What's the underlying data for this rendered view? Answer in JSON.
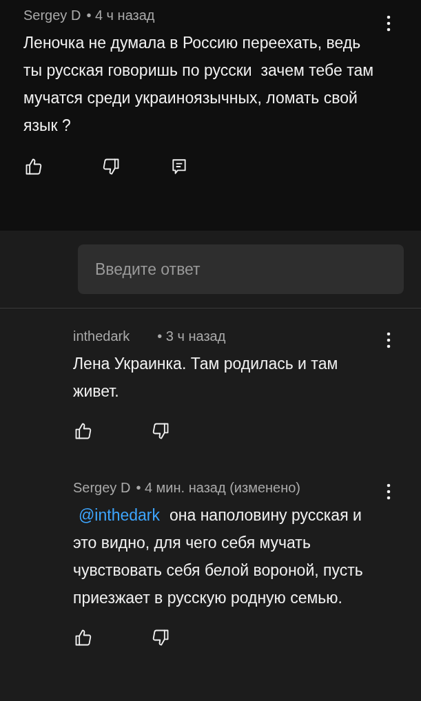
{
  "comment": {
    "author": "Sergey D",
    "time": "• 4 ч назад",
    "text": "Леночка не думала в Россию переехать, ведь ты русская говоришь по русски  зачем тебе там мучатся среди украиноязычных, ломать свой язык ?"
  },
  "reply_field": {
    "placeholder": "Введите ответ"
  },
  "replies": [
    {
      "author": "inthedark",
      "time": "• 3 ч назад",
      "text": "Лена Украинка. Там родилась и там живет."
    },
    {
      "author": "Sergey D",
      "time": "• 4 мин. назад (изменено)",
      "mention": "@inthedark",
      "text": "она наполовину русская и это видно, для чего себя мучать чувствовать себя белой вороной, пусть приезжает в русскую родную семью."
    }
  ]
}
